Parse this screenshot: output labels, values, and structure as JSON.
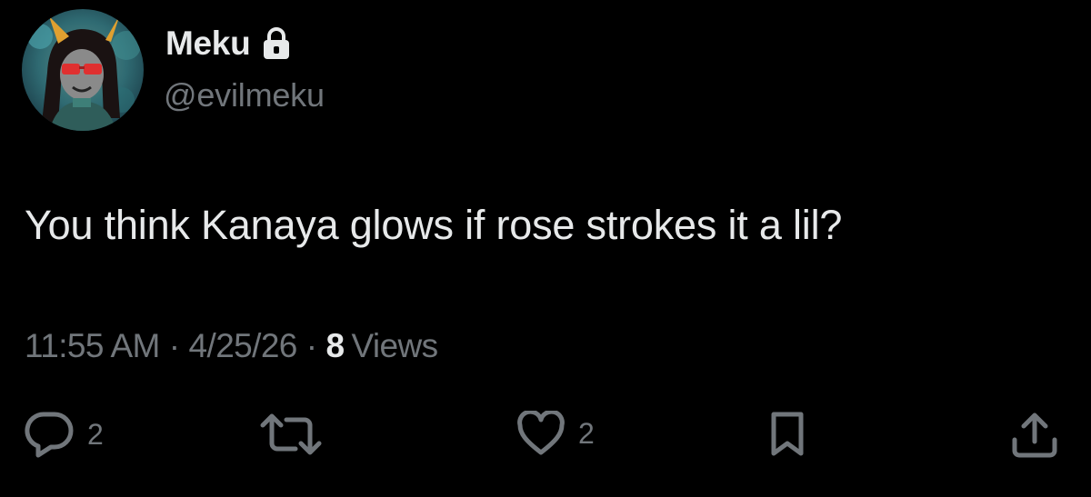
{
  "author": {
    "display_name": "Meku",
    "handle": "@evilmeku",
    "protected_icon": "lock-icon",
    "avatar_icon": "avatar"
  },
  "tweet": {
    "text": "You think Kanaya glows if rose strokes it a lil?",
    "time": "11:55 AM",
    "date": "4/25/26",
    "separator": "·",
    "views_count": "8",
    "views_label": "Views"
  },
  "actions": {
    "reply": {
      "icon": "reply-icon",
      "count": "2"
    },
    "retweet": {
      "icon": "retweet-icon",
      "count": ""
    },
    "like": {
      "icon": "heart-icon",
      "count": "2"
    },
    "bookmark": {
      "icon": "bookmark-icon"
    },
    "share": {
      "icon": "share-icon"
    }
  },
  "colors": {
    "background": "#000000",
    "primary_text": "#e7e9ea",
    "secondary_text": "#71767b"
  }
}
